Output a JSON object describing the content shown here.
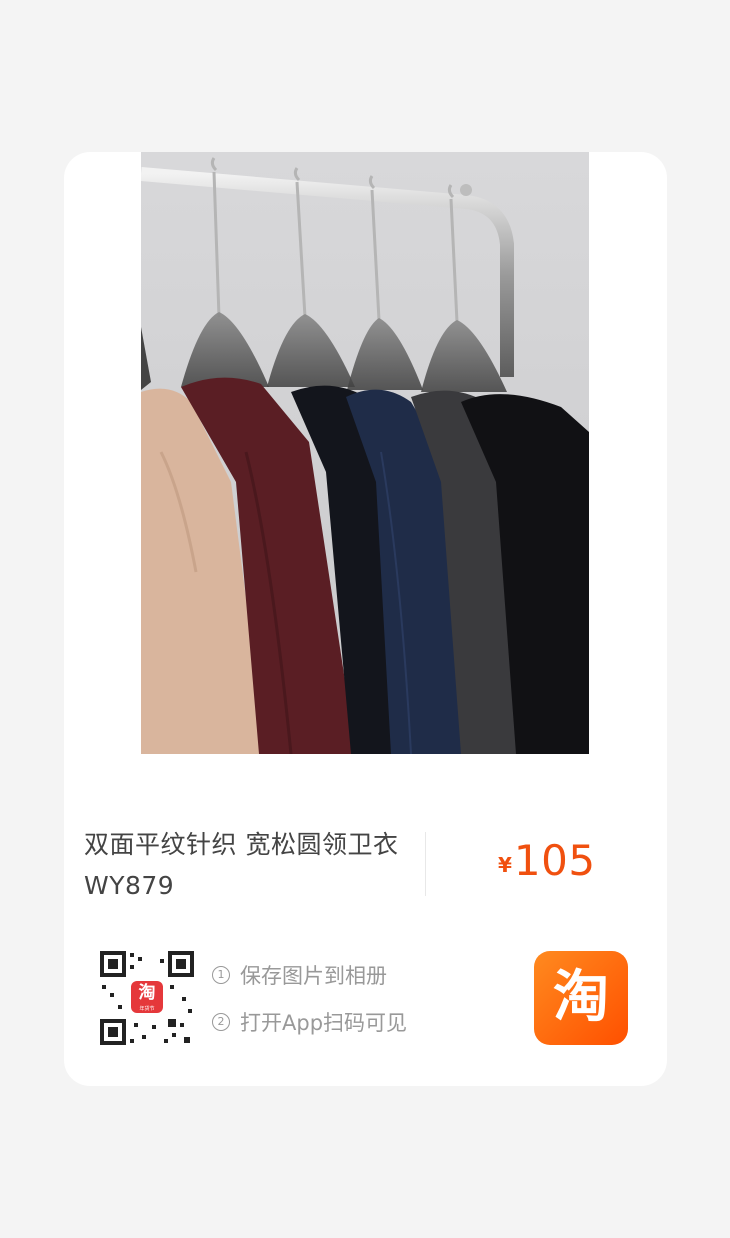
{
  "product": {
    "title": "双面平纹针织 宽松圆领卫衣 WY879",
    "currency": "¥",
    "price": "105"
  },
  "qr": {
    "badge_text": "淘",
    "badge_sub": "年货节"
  },
  "instructions": {
    "step1_num": "1",
    "step1_text": "保存图片到相册",
    "step2_num": "2",
    "step2_text": "打开App扫码可见"
  },
  "logo": {
    "text": "淘"
  },
  "colors": {
    "price": "#f0500f",
    "logo_gradient_start": "#ff8a1f",
    "logo_gradient_end": "#ff5000",
    "background": "#f4f4f4"
  },
  "icons": [
    "qr-code-icon",
    "taobao-logo-icon"
  ]
}
